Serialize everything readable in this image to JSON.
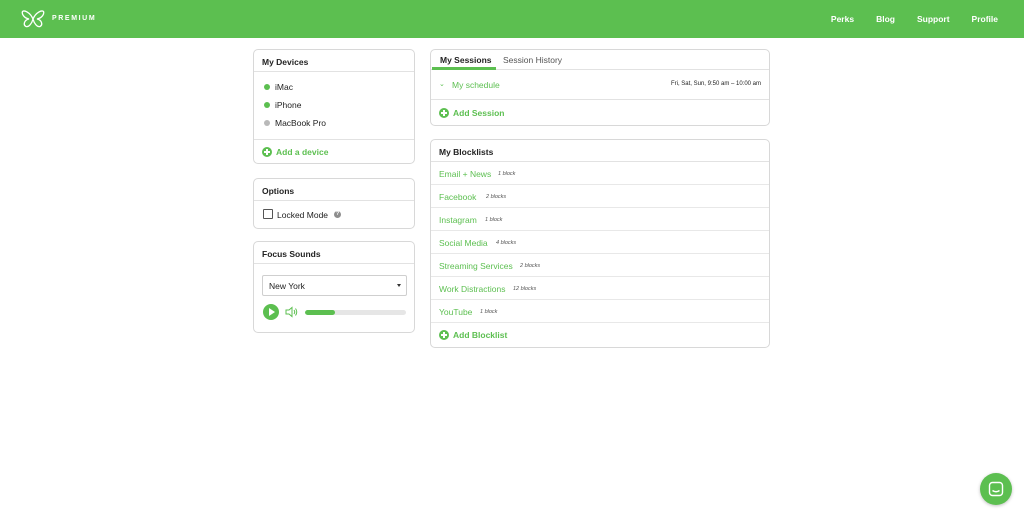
{
  "header": {
    "brand": "PREMIUM",
    "nav": [
      "Perks",
      "Blog",
      "Support",
      "Profile"
    ]
  },
  "devices": {
    "title": "My Devices",
    "items": [
      {
        "name": "iMac",
        "status": "online"
      },
      {
        "name": "iPhone",
        "status": "online"
      },
      {
        "name": "MacBook Pro",
        "status": "offline"
      }
    ],
    "add_label": "Add a device"
  },
  "options": {
    "title": "Options",
    "locked_mode_label": "Locked Mode",
    "locked_mode_checked": false
  },
  "focus_sounds": {
    "title": "Focus Sounds",
    "selected": "New York",
    "volume": 0.3
  },
  "sessions": {
    "tabs": [
      "My Sessions",
      "Session History"
    ],
    "active_tab": "My Sessions",
    "schedule_name": "My schedule",
    "schedule_time": "Fri, Sat, Sun, 9:50 am – 10:00 am",
    "add_label": "Add Session"
  },
  "blocklists": {
    "title": "My Blocklists",
    "items": [
      {
        "name": "Email + News",
        "count": "1 block"
      },
      {
        "name": "Facebook",
        "count": "2 blocks"
      },
      {
        "name": "Instagram",
        "count": "1 block"
      },
      {
        "name": "Social Media",
        "count": "4 blocks"
      },
      {
        "name": "Streaming Services",
        "count": "2 blocks"
      },
      {
        "name": "Work Distractions",
        "count": "12 blocks"
      },
      {
        "name": "YouTube",
        "count": "1 block"
      }
    ],
    "add_label": "Add Blocklist"
  },
  "colors": {
    "brand_green": "#5cbf50",
    "offline_grey": "#b9b9b9"
  },
  "icons": [
    "butterfly-logo-icon",
    "plus-circle-icon",
    "help-icon",
    "play-icon",
    "speaker-icon",
    "chevron-down-icon",
    "chat-icon"
  ]
}
